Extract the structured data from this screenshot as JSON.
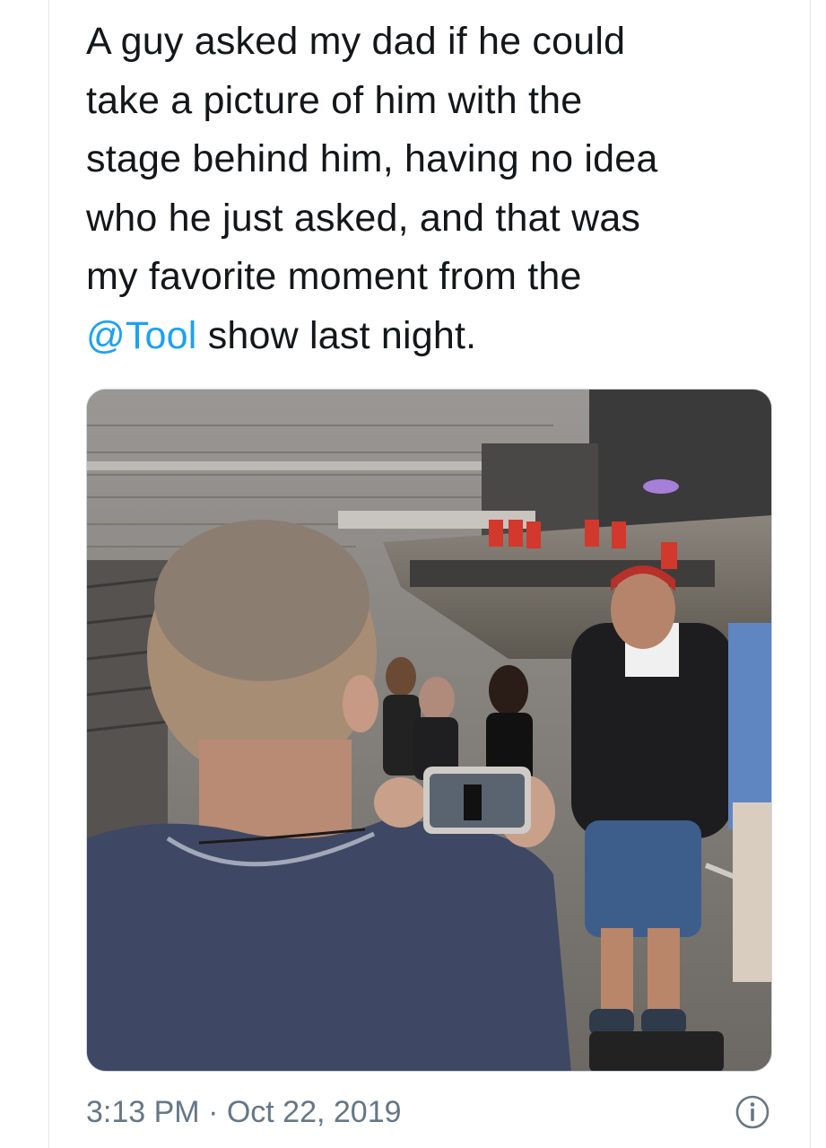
{
  "tweet": {
    "text_lines": [
      "A guy asked my dad if he could",
      "take a picture of him with the",
      "stage behind him, having no idea",
      "who he just asked, and that was",
      "my favorite moment from the"
    ],
    "last_line_mention": "@Tool",
    "last_line_rest": " show last night.",
    "time": "3:13 PM",
    "separator": " · ",
    "date": "Oct 22, 2019"
  },
  "icons": {
    "info": "info-icon"
  },
  "colors": {
    "text": "#14171a",
    "link": "#1da1f2",
    "meta": "#657786"
  }
}
